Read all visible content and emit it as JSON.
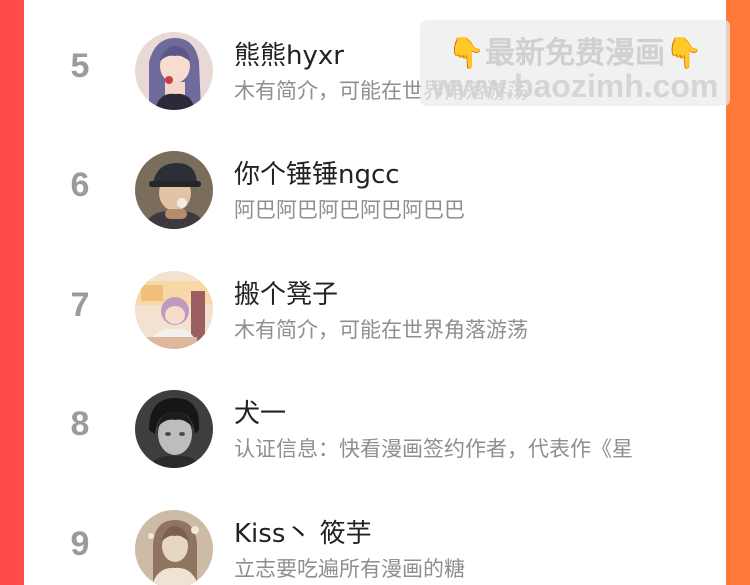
{
  "list": {
    "items": [
      {
        "rank": "5",
        "name": "熊熊hyxr",
        "description": "木有简介，可能在世界角落游荡",
        "avatar_icon": "anime-girl-avatar"
      },
      {
        "rank": "6",
        "name": "你个锤锤ngcc",
        "description": "阿巴阿巴阿巴阿巴阿巴巴",
        "avatar_icon": "boy-with-cap-avatar"
      },
      {
        "rank": "7",
        "name": "搬个凳子",
        "description": "木有简介，可能在世界角落游荡",
        "avatar_icon": "cartoon-room-avatar"
      },
      {
        "rank": "8",
        "name": "犬一",
        "description": "认证信息：快看漫画签约作者，代表作《星",
        "avatar_icon": "monochrome-portrait-avatar"
      },
      {
        "rank": "9",
        "name": "Kiss丶 筱芋",
        "description": "立志要吃遍所有漫画的糖",
        "avatar_icon": "sepia-girl-avatar"
      }
    ]
  },
  "watermark": {
    "line1": "最新免费漫画",
    "line2": "www.baozimh.com",
    "left_icon": "pointing-hand-icon",
    "right_icon": "pointing-hand-icon"
  },
  "colors": {
    "background_left": "#ff4b4b",
    "background_right": "#ff7a3a",
    "rank": "#9b9b9b",
    "name": "#222222",
    "description": "#8f8f8f"
  }
}
